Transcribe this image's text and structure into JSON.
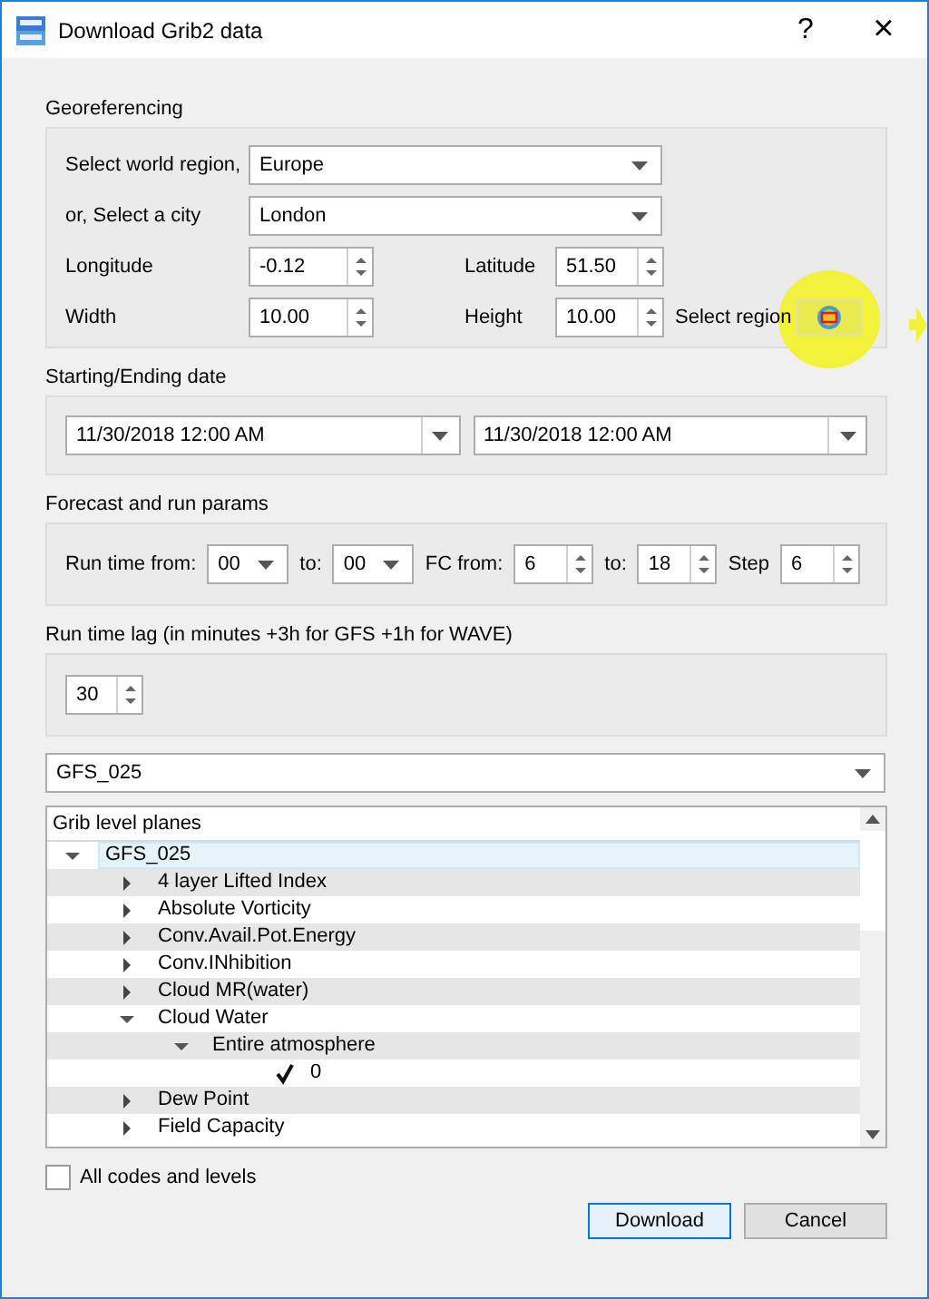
{
  "window": {
    "title": "Download Grib2 data",
    "help": "?",
    "close": "×"
  },
  "georeferencing": {
    "title": "Georeferencing",
    "world_region": {
      "label": "Select world region,",
      "value": "Europe"
    },
    "city": {
      "label": "or, Select a city",
      "value": "London"
    },
    "longitude": {
      "label": "Longitude",
      "value": "-0.12"
    },
    "latitude": {
      "label": "Latitude",
      "value": "51.50"
    },
    "width": {
      "label": "Width",
      "value": "10.00"
    },
    "height": {
      "label": "Height",
      "value": "10.00"
    },
    "select_region": {
      "label": "Select region"
    }
  },
  "dates": {
    "title": "Starting/Ending date",
    "start": "11/30/2018 12:00 AM",
    "end": "11/30/2018 12:00 AM"
  },
  "forecast": {
    "title": "Forecast and run params",
    "fields": [
      {
        "kind": "combo",
        "label": "Run time from:",
        "value": "00"
      },
      {
        "kind": "combo",
        "label": "to:",
        "value": "00"
      },
      {
        "kind": "spin",
        "label": "FC from:",
        "value": "6"
      },
      {
        "kind": "spin",
        "label": "to:",
        "value": "18"
      },
      {
        "kind": "spin",
        "label": "Step",
        "value": "6"
      }
    ]
  },
  "lag": {
    "title": "Run time lag (in minutes +3h for GFS +1h for WAVE)",
    "value": "30"
  },
  "model": {
    "value": "GFS_025"
  },
  "tree": {
    "header": "Grib level planes",
    "items": [
      {
        "kind": "node",
        "label": "GFS_025",
        "expanded": true,
        "selected": true,
        "children": [
          {
            "kind": "node",
            "label": "4 layer Lifted Index",
            "expanded": false,
            "selected": false
          },
          {
            "kind": "node",
            "label": "Absolute Vorticity",
            "expanded": false,
            "selected": false
          },
          {
            "kind": "node",
            "label": "Conv.Avail.Pot.Energy",
            "expanded": false,
            "selected": false
          },
          {
            "kind": "node",
            "label": "Conv.INhibition",
            "expanded": false,
            "selected": false
          },
          {
            "kind": "node",
            "label": "Cloud MR(water)",
            "expanded": false,
            "selected": false
          },
          {
            "kind": "node",
            "label": "Cloud Water",
            "expanded": true,
            "selected": false,
            "children": [
              {
                "kind": "node",
                "label": "Entire atmosphere",
                "expanded": true,
                "selected": false,
                "children": [
                  {
                    "kind": "check",
                    "label": "0",
                    "checked": true,
                    "selected": false
                  }
                ]
              }
            ]
          },
          {
            "kind": "node",
            "label": "Dew Point",
            "expanded": false,
            "selected": false
          },
          {
            "kind": "node",
            "label": "Field Capacity",
            "expanded": false,
            "selected": false
          }
        ]
      }
    ]
  },
  "all_codes": {
    "label": "All codes and levels",
    "checked": false
  },
  "buttons": [
    {
      "label": "Download",
      "default": true
    },
    {
      "label": "Cancel",
      "default": false
    }
  ]
}
